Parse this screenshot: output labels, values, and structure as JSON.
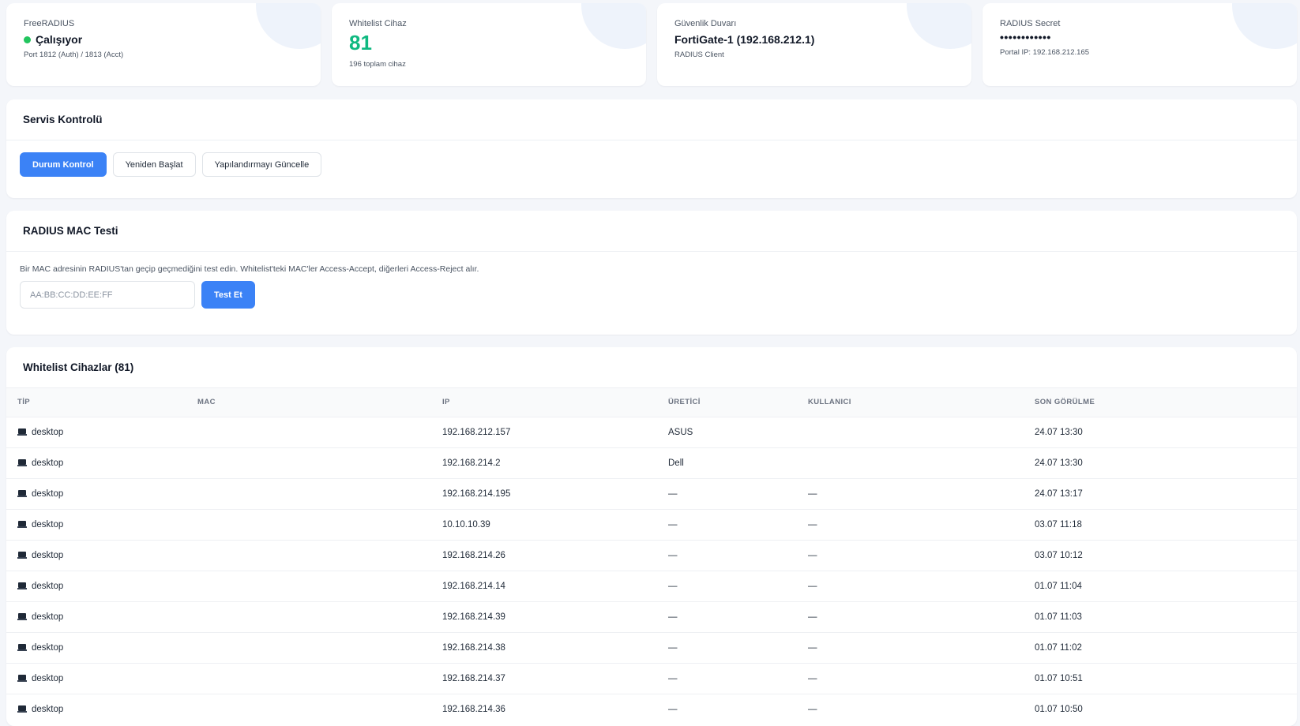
{
  "stats": [
    {
      "label": "FreeRADIUS",
      "value": "Çalışıyor",
      "sub": "Port 1812 (Auth) / 1813 (Acct)",
      "status_color": "#22c55e"
    },
    {
      "label": "Whitelist Cihaz",
      "value": "81",
      "sub": "196 toplam cihaz",
      "value_color": "#10b981"
    },
    {
      "label": "Güvenlik Duvarı",
      "value": "FortiGate-1 (192.168.212.1)",
      "sub": "RADIUS Client"
    },
    {
      "label": "RADIUS Secret",
      "value": "••••••••••••",
      "sub": "Portal IP: 192.168.212.165"
    }
  ],
  "service": {
    "title": "Servis Kontrolü",
    "buttons": [
      "Durum Kontrol",
      "Yeniden Başlat",
      "Yapılandırmayı Güncelle"
    ]
  },
  "mac_test": {
    "title": "RADIUS MAC Testi",
    "description": "Bir MAC adresinin RADIUS'tan geçip geçmediğini test edin. Whitelist'teki MAC'ler Access-Accept, diğerleri Access-Reject alır.",
    "placeholder": "AA:BB:CC:DD:EE:FF",
    "button": "Test Et"
  },
  "whitelist": {
    "title": "Whitelist Cihazlar (81)",
    "columns": [
      "TİP",
      "MAC",
      "IP",
      "ÜRETİCİ",
      "KULLANICI",
      "SON GÖRÜLME"
    ],
    "rows": [
      {
        "type": "desktop",
        "ip": "192.168.212.157",
        "vendor": "ASUS",
        "user": "",
        "last_seen": "24.07 13:30"
      },
      {
        "type": "desktop",
        "ip": "192.168.214.2",
        "vendor": "Dell",
        "user": "",
        "last_seen": "24.07 13:30"
      },
      {
        "type": "desktop",
        "ip": "192.168.214.195",
        "vendor": "—",
        "user": "—",
        "last_seen": "24.07 13:17"
      },
      {
        "type": "desktop",
        "ip": "10.10.10.39",
        "vendor": "—",
        "user": "—",
        "last_seen": "03.07 11:18"
      },
      {
        "type": "desktop",
        "ip": "192.168.214.26",
        "vendor": "—",
        "user": "—",
        "last_seen": "03.07 10:12"
      },
      {
        "type": "desktop",
        "ip": "192.168.214.14",
        "vendor": "—",
        "user": "—",
        "last_seen": "01.07 11:04"
      },
      {
        "type": "desktop",
        "ip": "192.168.214.39",
        "vendor": "—",
        "user": "—",
        "last_seen": "01.07 11:03"
      },
      {
        "type": "desktop",
        "ip": "192.168.214.38",
        "vendor": "—",
        "user": "—",
        "last_seen": "01.07 11:02"
      },
      {
        "type": "desktop",
        "ip": "192.168.214.37",
        "vendor": "—",
        "user": "—",
        "last_seen": "01.07 10:51"
      },
      {
        "type": "desktop",
        "ip": "192.168.214.36",
        "vendor": "—",
        "user": "—",
        "last_seen": "01.07 10:50"
      }
    ]
  }
}
